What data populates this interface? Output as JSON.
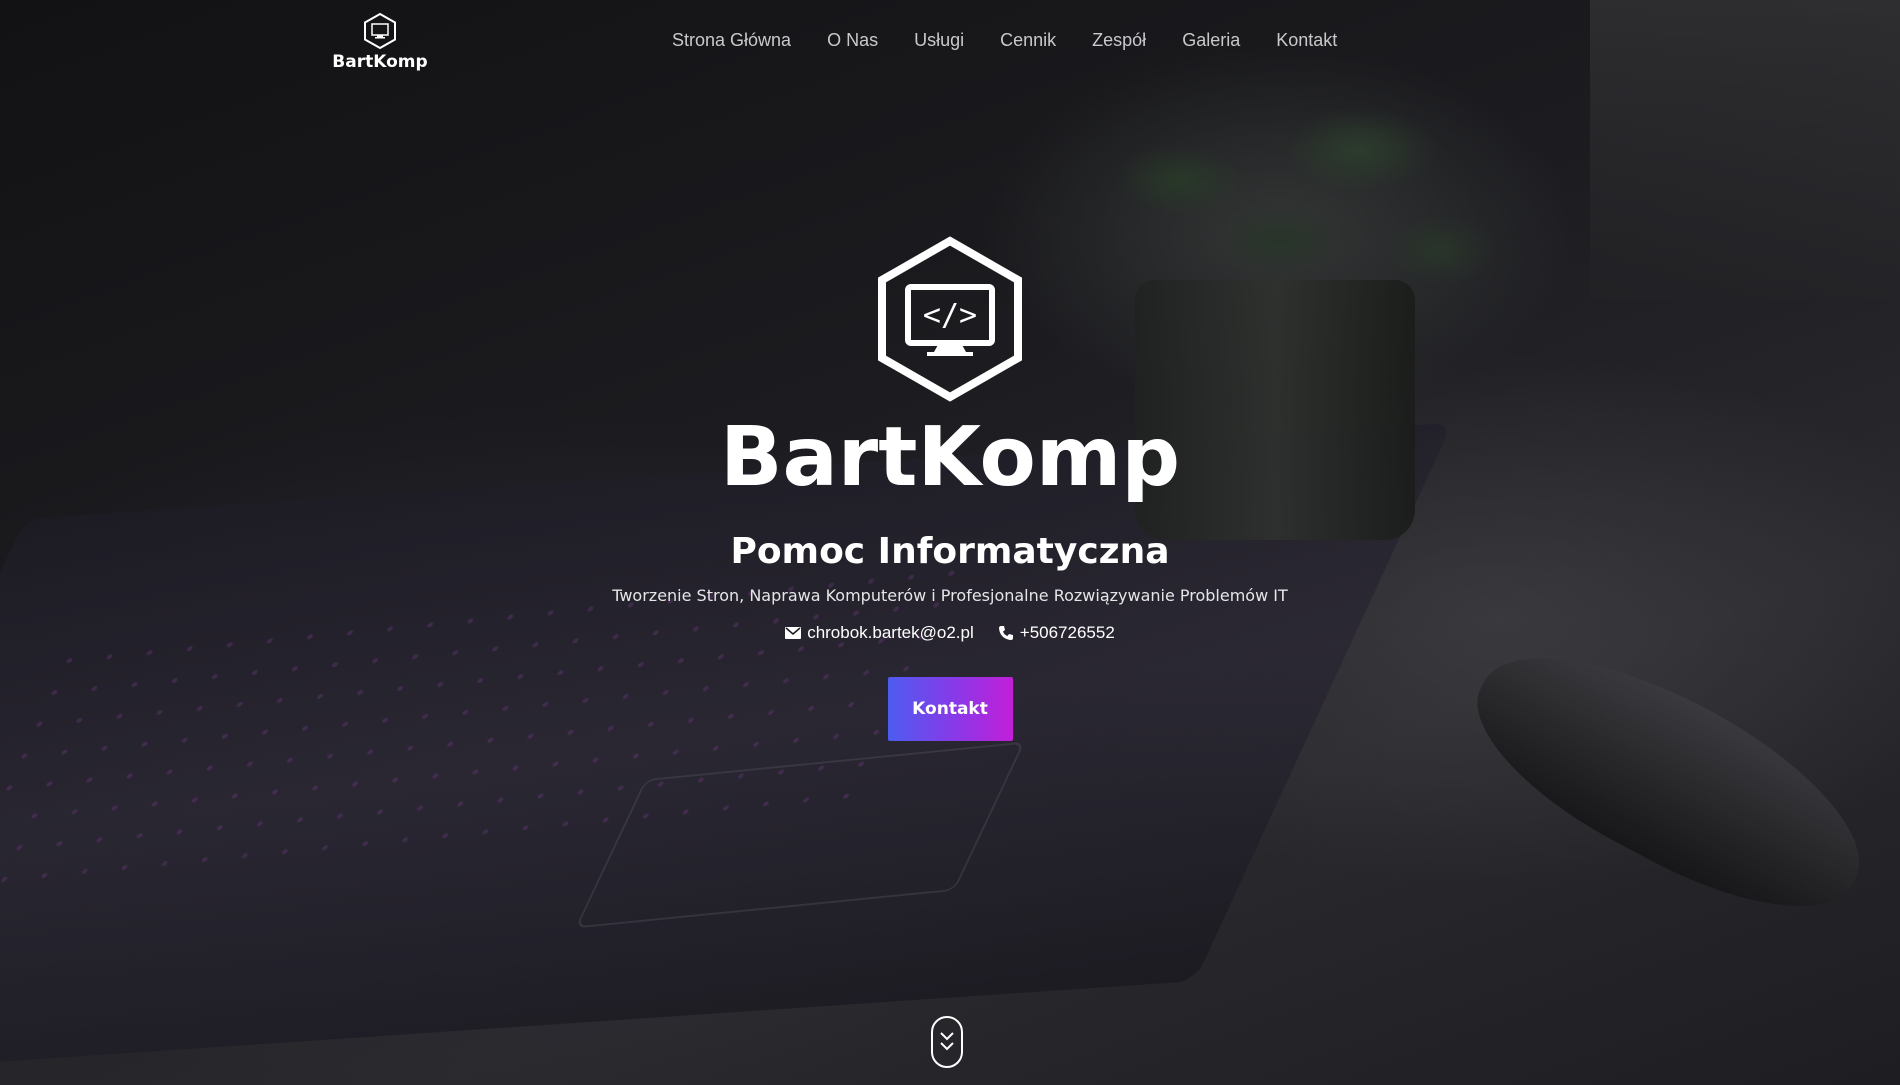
{
  "brand": {
    "name": "BartKomp",
    "icon": "hexagon-monitor-code-icon"
  },
  "nav": {
    "items": [
      {
        "label": "Strona Główna"
      },
      {
        "label": "O Nas"
      },
      {
        "label": "Usługi"
      },
      {
        "label": "Cennik"
      },
      {
        "label": "Zespół"
      },
      {
        "label": "Galeria"
      },
      {
        "label": "Kontakt"
      }
    ]
  },
  "hero": {
    "logo_code_text": "</>",
    "title": "BartKomp",
    "subtitle": "Pomoc Informatyczna",
    "description": "Tworzenie Stron, Naprawa Komputerów i Profesjonalne Rozwiązywanie Problemów IT",
    "email": "chrobok.bartek@o2.pl",
    "email_icon": "envelope-icon",
    "phone": "+506726552",
    "phone_icon": "phone-icon",
    "cta_label": "Kontakt",
    "scroll_icon": "chevron-down-icon"
  },
  "colors": {
    "cta_gradient_start": "#4d5cf0",
    "cta_gradient_end": "#c21fd8",
    "nav_text": "#c9c9cc",
    "text": "#ffffff"
  }
}
